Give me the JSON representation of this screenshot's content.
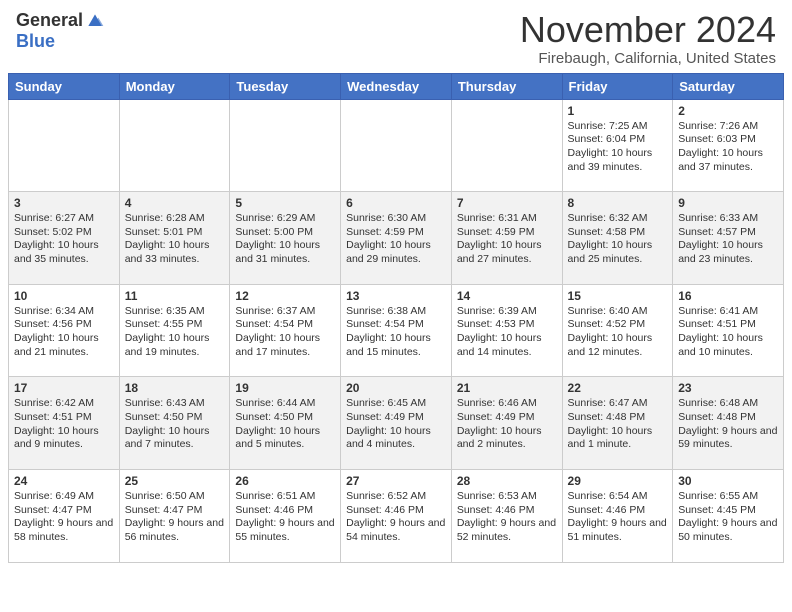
{
  "header": {
    "logo_general": "General",
    "logo_blue": "Blue",
    "month_title": "November 2024",
    "location": "Firebaugh, California, United States"
  },
  "calendar": {
    "days_of_week": [
      "Sunday",
      "Monday",
      "Tuesday",
      "Wednesday",
      "Thursday",
      "Friday",
      "Saturday"
    ],
    "weeks": [
      [
        {
          "day": "",
          "info": ""
        },
        {
          "day": "",
          "info": ""
        },
        {
          "day": "",
          "info": ""
        },
        {
          "day": "",
          "info": ""
        },
        {
          "day": "",
          "info": ""
        },
        {
          "day": "1",
          "info": "Sunrise: 7:25 AM\nSunset: 6:04 PM\nDaylight: 10 hours and 39 minutes."
        },
        {
          "day": "2",
          "info": "Sunrise: 7:26 AM\nSunset: 6:03 PM\nDaylight: 10 hours and 37 minutes."
        }
      ],
      [
        {
          "day": "3",
          "info": "Sunrise: 6:27 AM\nSunset: 5:02 PM\nDaylight: 10 hours and 35 minutes."
        },
        {
          "day": "4",
          "info": "Sunrise: 6:28 AM\nSunset: 5:01 PM\nDaylight: 10 hours and 33 minutes."
        },
        {
          "day": "5",
          "info": "Sunrise: 6:29 AM\nSunset: 5:00 PM\nDaylight: 10 hours and 31 minutes."
        },
        {
          "day": "6",
          "info": "Sunrise: 6:30 AM\nSunset: 4:59 PM\nDaylight: 10 hours and 29 minutes."
        },
        {
          "day": "7",
          "info": "Sunrise: 6:31 AM\nSunset: 4:59 PM\nDaylight: 10 hours and 27 minutes."
        },
        {
          "day": "8",
          "info": "Sunrise: 6:32 AM\nSunset: 4:58 PM\nDaylight: 10 hours and 25 minutes."
        },
        {
          "day": "9",
          "info": "Sunrise: 6:33 AM\nSunset: 4:57 PM\nDaylight: 10 hours and 23 minutes."
        }
      ],
      [
        {
          "day": "10",
          "info": "Sunrise: 6:34 AM\nSunset: 4:56 PM\nDaylight: 10 hours and 21 minutes."
        },
        {
          "day": "11",
          "info": "Sunrise: 6:35 AM\nSunset: 4:55 PM\nDaylight: 10 hours and 19 minutes."
        },
        {
          "day": "12",
          "info": "Sunrise: 6:37 AM\nSunset: 4:54 PM\nDaylight: 10 hours and 17 minutes."
        },
        {
          "day": "13",
          "info": "Sunrise: 6:38 AM\nSunset: 4:54 PM\nDaylight: 10 hours and 15 minutes."
        },
        {
          "day": "14",
          "info": "Sunrise: 6:39 AM\nSunset: 4:53 PM\nDaylight: 10 hours and 14 minutes."
        },
        {
          "day": "15",
          "info": "Sunrise: 6:40 AM\nSunset: 4:52 PM\nDaylight: 10 hours and 12 minutes."
        },
        {
          "day": "16",
          "info": "Sunrise: 6:41 AM\nSunset: 4:51 PM\nDaylight: 10 hours and 10 minutes."
        }
      ],
      [
        {
          "day": "17",
          "info": "Sunrise: 6:42 AM\nSunset: 4:51 PM\nDaylight: 10 hours and 9 minutes."
        },
        {
          "day": "18",
          "info": "Sunrise: 6:43 AM\nSunset: 4:50 PM\nDaylight: 10 hours and 7 minutes."
        },
        {
          "day": "19",
          "info": "Sunrise: 6:44 AM\nSunset: 4:50 PM\nDaylight: 10 hours and 5 minutes."
        },
        {
          "day": "20",
          "info": "Sunrise: 6:45 AM\nSunset: 4:49 PM\nDaylight: 10 hours and 4 minutes."
        },
        {
          "day": "21",
          "info": "Sunrise: 6:46 AM\nSunset: 4:49 PM\nDaylight: 10 hours and 2 minutes."
        },
        {
          "day": "22",
          "info": "Sunrise: 6:47 AM\nSunset: 4:48 PM\nDaylight: 10 hours and 1 minute."
        },
        {
          "day": "23",
          "info": "Sunrise: 6:48 AM\nSunset: 4:48 PM\nDaylight: 9 hours and 59 minutes."
        }
      ],
      [
        {
          "day": "24",
          "info": "Sunrise: 6:49 AM\nSunset: 4:47 PM\nDaylight: 9 hours and 58 minutes."
        },
        {
          "day": "25",
          "info": "Sunrise: 6:50 AM\nSunset: 4:47 PM\nDaylight: 9 hours and 56 minutes."
        },
        {
          "day": "26",
          "info": "Sunrise: 6:51 AM\nSunset: 4:46 PM\nDaylight: 9 hours and 55 minutes."
        },
        {
          "day": "27",
          "info": "Sunrise: 6:52 AM\nSunset: 4:46 PM\nDaylight: 9 hours and 54 minutes."
        },
        {
          "day": "28",
          "info": "Sunrise: 6:53 AM\nSunset: 4:46 PM\nDaylight: 9 hours and 52 minutes."
        },
        {
          "day": "29",
          "info": "Sunrise: 6:54 AM\nSunset: 4:46 PM\nDaylight: 9 hours and 51 minutes."
        },
        {
          "day": "30",
          "info": "Sunrise: 6:55 AM\nSunset: 4:45 PM\nDaylight: 9 hours and 50 minutes."
        }
      ]
    ]
  }
}
